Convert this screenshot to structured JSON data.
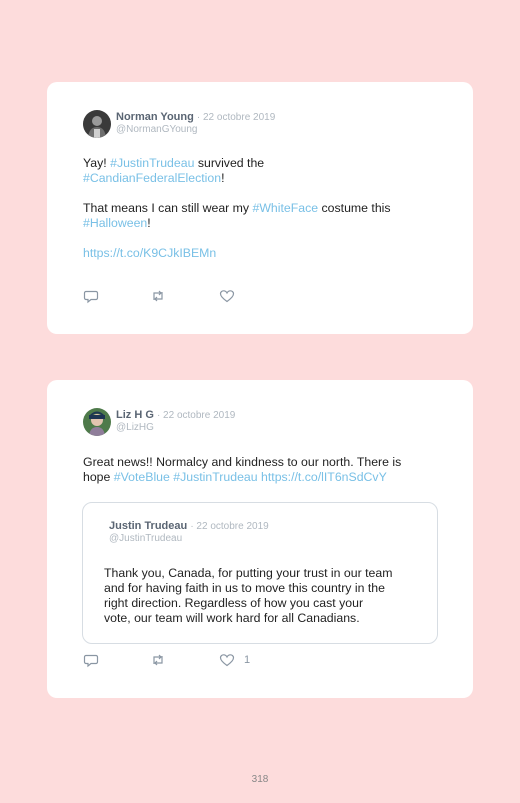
{
  "tweets": [
    {
      "author": "Norman Young",
      "date": "· 22 octobre 2019",
      "handle": "@NormanGYoung",
      "line1_pre": "Yay! ",
      "line1_tag": "#JustinTrudeau",
      "line1_post": " survived the",
      "line2_tag": "#CandianFederalElection",
      "line2_post": "!",
      "para2_pre": "That means I can still wear my ",
      "para2_tag": "#WhiteFace",
      "para2_post": " costume this",
      "para2_line2_tag": "#Halloween",
      "para2_line2_post": "!",
      "link": "https://t.co/K9CJkIBEMn",
      "like_count": ""
    },
    {
      "author": "Liz H G",
      "date": "· 22 octobre 2019",
      "handle": "@LizHG",
      "line1": "Great news!! Normalcy and kindness to our north. There is",
      "line2_pre": "hope ",
      "line2_tag1": "#VoteBlue",
      "line2_tag2": "#JustinTrudeau",
      "line2_link": "https://t.co/lIT6nSdCvY",
      "like_count": "1",
      "quote": {
        "author": "Justin Trudeau",
        "date": "· 22 octobre 2019",
        "handle": "@JustinTrudeau",
        "lines": [
          "Thank you, Canada, for putting your trust in our team",
          "and for having faith in us to move this country in the",
          "right direction. Regardless of how you cast your",
          "vote, our team will work hard for all Canadians."
        ]
      }
    }
  ],
  "icons": [
    "reply-icon",
    "retweet-icon",
    "like-icon"
  ],
  "colors": {
    "background": "#fddcdc",
    "link": "#79c0e6",
    "card": "#ffffff"
  },
  "page_number": "318"
}
